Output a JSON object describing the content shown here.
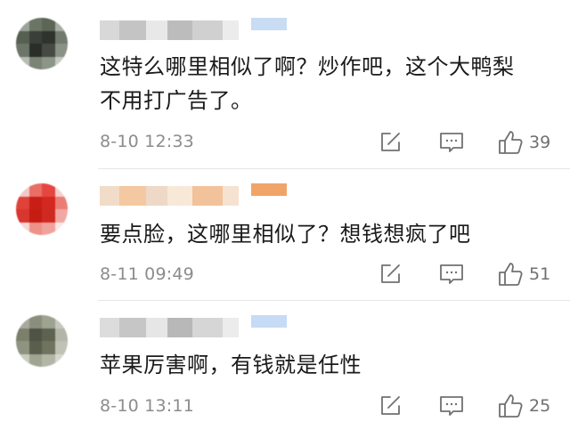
{
  "comments": [
    {
      "text": "这特么哪里相似了啊？炒作吧，这个大鸭梨\n不用打广告了。",
      "time": "8-10 12:33",
      "likes": "39",
      "avatar_pixels": [
        "#9aa39a",
        "#6a7565",
        "#5c6657",
        "#a7ada5",
        "#555f52",
        "#3b3f3a",
        "#2e332d",
        "#717a6c",
        "#6d7568",
        "#2a2e29",
        "#454b42",
        "#8a9186",
        "#b7bcb4",
        "#7b8377",
        "#8d9488",
        "#c6cac3"
      ],
      "name_pixels": [
        "#d8d8d8",
        "#c4c4c4",
        "#e8e8e8",
        "#bcbcbc",
        "#d0d0d0",
        "#ececec",
        "#c8dcf4"
      ]
    },
    {
      "text": "要点脸，这哪里相似了？想钱想疯了吧",
      "time": "8-11 09:49",
      "likes": "51",
      "avatar_pixels": [
        "#f2c9c9",
        "#e86e66",
        "#e5463f",
        "#f4d0cd",
        "#e0423a",
        "#c81e16",
        "#d2281f",
        "#ec7d75",
        "#d8362e",
        "#c51c14",
        "#cf2a22",
        "#f1a8a2",
        "#f6d8d5",
        "#ee9189",
        "#f0a39c",
        "#fbe7e5"
      ],
      "name_pixels": [
        "#f0dcc8",
        "#f4c8a0",
        "#eed8c6",
        "#f8e8d8",
        "#f2c29a",
        "#f6e2d0",
        "#f1a468"
      ]
    },
    {
      "text": "苹果厉害啊，有钱就是任性",
      "time": "8-10 13:11",
      "likes": "25",
      "avatar_pixels": [
        "#a7ab9d",
        "#8a8e7d",
        "#9ea291",
        "#c5c8bd",
        "#7c806b",
        "#4f5245",
        "#5e6250",
        "#b2b5a8",
        "#8f9480",
        "#5a5e4c",
        "#6f735f",
        "#bfc2b4",
        "#c9ccc1",
        "#a0a492",
        "#b3b6a7",
        "#d6d8cf"
      ],
      "name_pixels": [
        "#dcdcdc",
        "#c6c6c6",
        "#e6e6e6",
        "#b8b8b8",
        "#d6d6d6",
        "#ececec",
        "#c6dbf5"
      ]
    }
  ],
  "icons": {
    "share": "share-edit-icon",
    "reply": "comment-bubble-icon",
    "like": "thumbs-up-icon"
  },
  "colors": {
    "text": "#1a1a1a",
    "meta": "#8c8c8c",
    "icon": "#707070",
    "divider": "#e6e6e6"
  }
}
